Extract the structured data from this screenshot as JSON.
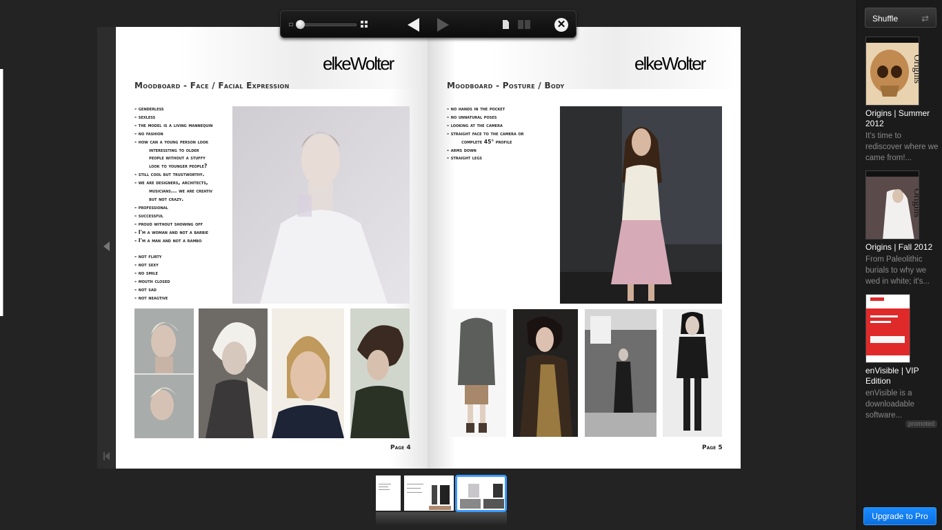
{
  "toolbar": {
    "zoom_level": 0,
    "close_symbol": "✕"
  },
  "book": {
    "left_page": {
      "logo": "elkeWolter",
      "title": "Moodboard - Face / Facial Expression",
      "bullets": [
        "- genderless",
        "- sexless",
        "- the model is a living mannequin",
        "- no fashion",
        "- how can a young person look",
        "        interessting to older",
        "        people without a stuffy",
        "        look to younger people?",
        "- still cool but trustworthy.",
        "- we are designers, architects,",
        "        musicians... we are creativ",
        "        but not crazy.",
        "- professional",
        "- successful",
        "- proud without showing off",
        "- I'm a woman and not a barbie",
        "- I'm a man and not a rambo",
        "",
        "- not flirty",
        "- not sexy",
        "- no smile",
        "- mouth closed",
        "- not sad",
        "- not neagtive"
      ],
      "page_number": "Page 4"
    },
    "right_page": {
      "logo": "elkeWolter",
      "title": "Moodboard - Posture / Body",
      "bullets": [
        "- no hands in the pocket",
        "- no unnatural poses",
        "- looking at the camera",
        "- straight face to the camera or",
        "        complete 45° profile",
        "- arms down",
        "- straight legs"
      ],
      "page_number": "Page 5"
    }
  },
  "sidebar": {
    "shuffle_label": "Shuffle",
    "publications": [
      {
        "title": "Origins | Summer 2012",
        "description": "It's time to rediscover where we came from!...",
        "cover_color": "#c8a070"
      },
      {
        "title": "Origins | Fall 2012",
        "description": "From Paleolithic burials to why we wed in white; it's...",
        "cover_color": "#b0a0a0"
      },
      {
        "title": "enVisible | VIP Edition",
        "description": "enVisible is a downloadable software...",
        "cover_color": "#e03030"
      }
    ],
    "promoted_label": "promoted",
    "upgrade_label": "Upgrade to Pro"
  },
  "colors": {
    "background": "#232323",
    "accent_blue": "#0b6fe0",
    "thumb_active_border": "#3a9aff"
  }
}
